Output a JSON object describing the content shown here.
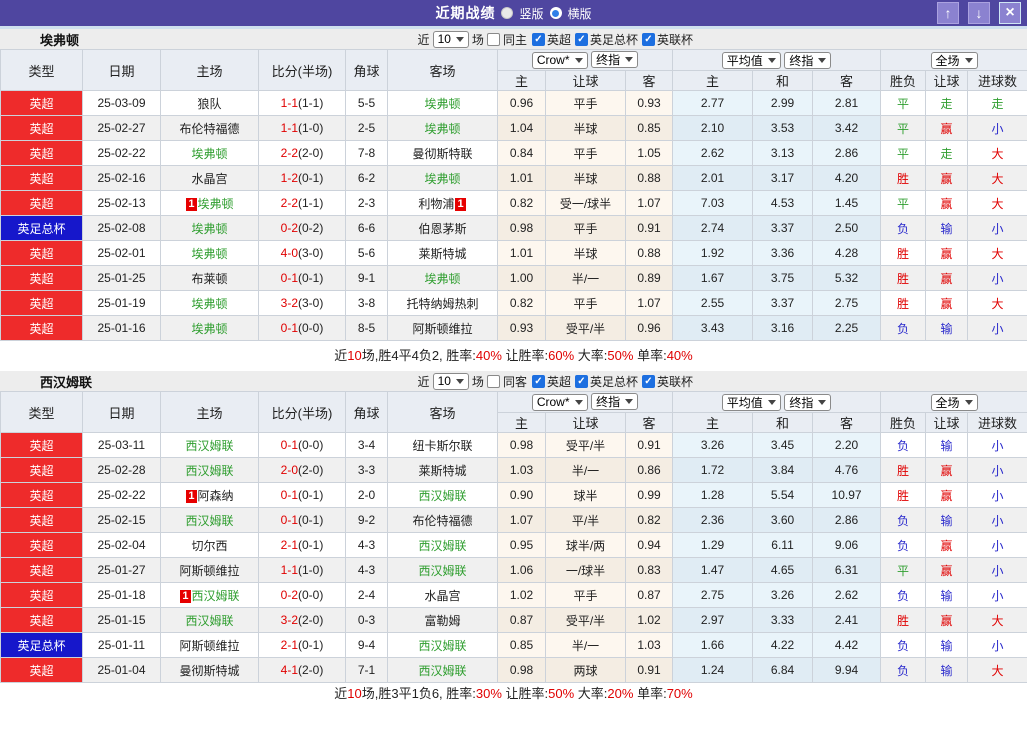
{
  "titlebar": {
    "title": "近期战绩",
    "radio_vertical": "竖版",
    "radio_horizontal": "横版",
    "up_button": "↑",
    "down_button": "↓",
    "close_button": "×"
  },
  "colors": {
    "header_purple": "#4f46a0",
    "league_red": "#ee2b2b",
    "cup_blue": "#1617cb",
    "team_green": "#2f9e2f",
    "score_red": "#e60000",
    "result_red": "#e00000",
    "result_blue": "#2929cc",
    "result_green": "#2f9e2f"
  },
  "controls": {
    "near_label": "近",
    "matches_value": "10",
    "matches_suffix": "场",
    "league_options": [
      "英超",
      "英足总杯",
      "英联杯"
    ]
  },
  "table_header": {
    "type": "类型",
    "date": "日期",
    "home": "主场",
    "score": "比分(半场)",
    "corner": "角球",
    "away": "客场",
    "group1": [
      "Crow*",
      "终指"
    ],
    "group2": [
      "平均值",
      "终指"
    ],
    "group3": [
      "全场"
    ],
    "sub1": [
      "主",
      "让球",
      "客"
    ],
    "sub2": [
      "主",
      "和",
      "客"
    ],
    "sub3": [
      "胜负",
      "让球",
      "进球数"
    ]
  },
  "sections": [
    {
      "team": "埃弗顿",
      "same_label": "同主",
      "rows": [
        {
          "lg": "英超",
          "lgc": "r",
          "date": "25-03-09",
          "home": {
            "t": "狼队"
          },
          "score": "1-1",
          "half": "(1-1)",
          "cor": "5-5",
          "away": {
            "t": "埃弗顿",
            "g": 1
          },
          "hc": [
            "0.96",
            "平手",
            "0.93"
          ],
          "avg": [
            "2.77",
            "2.99",
            "2.81"
          ],
          "res": [
            [
              "平",
              "g"
            ],
            [
              "走",
              "g"
            ],
            [
              "走",
              "g"
            ]
          ]
        },
        {
          "lg": "英超",
          "lgc": "r",
          "date": "25-02-27",
          "home": {
            "t": "布伦特福德"
          },
          "score": "1-1",
          "half": "(1-0)",
          "cor": "2-5",
          "away": {
            "t": "埃弗顿",
            "g": 1
          },
          "hc": [
            "1.04",
            "半球",
            "0.85"
          ],
          "avg": [
            "2.10",
            "3.53",
            "3.42"
          ],
          "res": [
            [
              "平",
              "g"
            ],
            [
              "赢",
              "r"
            ],
            [
              "小",
              "b"
            ]
          ]
        },
        {
          "lg": "英超",
          "lgc": "r",
          "date": "25-02-22",
          "home": {
            "t": "埃弗顿",
            "g": 1
          },
          "score": "2-2",
          "half": "(2-0)",
          "cor": "7-8",
          "away": {
            "t": "曼彻斯特联"
          },
          "hc": [
            "0.84",
            "平手",
            "1.05"
          ],
          "avg": [
            "2.62",
            "3.13",
            "2.86"
          ],
          "res": [
            [
              "平",
              "g"
            ],
            [
              "走",
              "g"
            ],
            [
              "大",
              "r"
            ]
          ]
        },
        {
          "lg": "英超",
          "lgc": "r",
          "date": "25-02-16",
          "home": {
            "t": "水晶宫"
          },
          "score": "1-2",
          "half": "(0-1)",
          "cor": "6-2",
          "away": {
            "t": "埃弗顿",
            "g": 1
          },
          "hc": [
            "1.01",
            "半球",
            "0.88"
          ],
          "avg": [
            "2.01",
            "3.17",
            "4.20"
          ],
          "res": [
            [
              "胜",
              "r"
            ],
            [
              "赢",
              "r"
            ],
            [
              "大",
              "r"
            ]
          ]
        },
        {
          "lg": "英超",
          "lgc": "r",
          "date": "25-02-13",
          "home": {
            "t": "埃弗顿",
            "g": 1,
            "pre": "1"
          },
          "score": "2-2",
          "half": "(1-1)",
          "cor": "2-3",
          "away": {
            "t": "利物浦",
            "post": "1"
          },
          "hc": [
            "0.82",
            "受一/球半",
            "1.07"
          ],
          "avg": [
            "7.03",
            "4.53",
            "1.45"
          ],
          "res": [
            [
              "平",
              "g"
            ],
            [
              "赢",
              "r"
            ],
            [
              "大",
              "r"
            ]
          ]
        },
        {
          "lg": "英足总杯",
          "lgc": "b",
          "date": "25-02-08",
          "home": {
            "t": "埃弗顿",
            "g": 1
          },
          "score": "0-2",
          "half": "(0-2)",
          "cor": "6-6",
          "away": {
            "t": "伯恩茅斯"
          },
          "hc": [
            "0.98",
            "平手",
            "0.91"
          ],
          "avg": [
            "2.74",
            "3.37",
            "2.50"
          ],
          "res": [
            [
              "负",
              "b"
            ],
            [
              "输",
              "b"
            ],
            [
              "小",
              "b"
            ]
          ]
        },
        {
          "lg": "英超",
          "lgc": "r",
          "date": "25-02-01",
          "home": {
            "t": "埃弗顿",
            "g": 1
          },
          "score": "4-0",
          "half": "(3-0)",
          "cor": "5-6",
          "away": {
            "t": "莱斯特城"
          },
          "hc": [
            "1.01",
            "半球",
            "0.88"
          ],
          "avg": [
            "1.92",
            "3.36",
            "4.28"
          ],
          "res": [
            [
              "胜",
              "r"
            ],
            [
              "赢",
              "r"
            ],
            [
              "大",
              "r"
            ]
          ]
        },
        {
          "lg": "英超",
          "lgc": "r",
          "date": "25-01-25",
          "home": {
            "t": "布莱顿"
          },
          "score": "0-1",
          "half": "(0-1)",
          "cor": "9-1",
          "away": {
            "t": "埃弗顿",
            "g": 1
          },
          "hc": [
            "1.00",
            "半/一",
            "0.89"
          ],
          "avg": [
            "1.67",
            "3.75",
            "5.32"
          ],
          "res": [
            [
              "胜",
              "r"
            ],
            [
              "赢",
              "r"
            ],
            [
              "小",
              "b"
            ]
          ]
        },
        {
          "lg": "英超",
          "lgc": "r",
          "date": "25-01-19",
          "home": {
            "t": "埃弗顿",
            "g": 1
          },
          "score": "3-2",
          "half": "(3-0)",
          "cor": "3-8",
          "away": {
            "t": "托特纳姆热刺"
          },
          "hc": [
            "0.82",
            "平手",
            "1.07"
          ],
          "avg": [
            "2.55",
            "3.37",
            "2.75"
          ],
          "res": [
            [
              "胜",
              "r"
            ],
            [
              "赢",
              "r"
            ],
            [
              "大",
              "r"
            ]
          ]
        },
        {
          "lg": "英超",
          "lgc": "r",
          "date": "25-01-16",
          "home": {
            "t": "埃弗顿",
            "g": 1
          },
          "score": "0-1",
          "half": "(0-0)",
          "cor": "8-5",
          "away": {
            "t": "阿斯顿维拉"
          },
          "hc": [
            "0.93",
            "受平/半",
            "0.96"
          ],
          "avg": [
            "3.43",
            "3.16",
            "2.25"
          ],
          "res": [
            [
              "负",
              "b"
            ],
            [
              "输",
              "b"
            ],
            [
              "小",
              "b"
            ]
          ]
        }
      ],
      "summary": [
        [
          "近",
          0
        ],
        [
          "10",
          1
        ],
        [
          "场,胜4平4负2, 胜率:",
          0
        ],
        [
          "40%",
          1
        ],
        [
          " 让胜率:",
          0
        ],
        [
          "60%",
          1
        ],
        [
          " 大率:",
          0
        ],
        [
          "50%",
          1
        ],
        [
          " 单率:",
          0
        ],
        [
          "40%",
          1
        ]
      ]
    },
    {
      "team": "西汉姆联",
      "same_label": "同客",
      "rows": [
        {
          "lg": "英超",
          "lgc": "r",
          "date": "25-03-11",
          "home": {
            "t": "西汉姆联",
            "g": 1
          },
          "score": "0-1",
          "half": "(0-0)",
          "cor": "3-4",
          "away": {
            "t": "纽卡斯尔联"
          },
          "hc": [
            "0.98",
            "受平/半",
            "0.91"
          ],
          "avg": [
            "3.26",
            "3.45",
            "2.20"
          ],
          "res": [
            [
              "负",
              "b"
            ],
            [
              "输",
              "b"
            ],
            [
              "小",
              "b"
            ]
          ]
        },
        {
          "lg": "英超",
          "lgc": "r",
          "date": "25-02-28",
          "home": {
            "t": "西汉姆联",
            "g": 1
          },
          "score": "2-0",
          "half": "(2-0)",
          "cor": "3-3",
          "away": {
            "t": "莱斯特城"
          },
          "hc": [
            "1.03",
            "半/一",
            "0.86"
          ],
          "avg": [
            "1.72",
            "3.84",
            "4.76"
          ],
          "res": [
            [
              "胜",
              "r"
            ],
            [
              "赢",
              "r"
            ],
            [
              "小",
              "b"
            ]
          ]
        },
        {
          "lg": "英超",
          "lgc": "r",
          "date": "25-02-22",
          "home": {
            "t": "阿森纳",
            "pre": "1"
          },
          "score": "0-1",
          "half": "(0-1)",
          "cor": "2-0",
          "away": {
            "t": "西汉姆联",
            "g": 1
          },
          "hc": [
            "0.90",
            "球半",
            "0.99"
          ],
          "avg": [
            "1.28",
            "5.54",
            "10.97"
          ],
          "res": [
            [
              "胜",
              "r"
            ],
            [
              "赢",
              "r"
            ],
            [
              "小",
              "b"
            ]
          ]
        },
        {
          "lg": "英超",
          "lgc": "r",
          "date": "25-02-15",
          "home": {
            "t": "西汉姆联",
            "g": 1
          },
          "score": "0-1",
          "half": "(0-1)",
          "cor": "9-2",
          "away": {
            "t": "布伦特福德"
          },
          "hc": [
            "1.07",
            "平/半",
            "0.82"
          ],
          "avg": [
            "2.36",
            "3.60",
            "2.86"
          ],
          "res": [
            [
              "负",
              "b"
            ],
            [
              "输",
              "b"
            ],
            [
              "小",
              "b"
            ]
          ]
        },
        {
          "lg": "英超",
          "lgc": "r",
          "date": "25-02-04",
          "home": {
            "t": "切尔西"
          },
          "score": "2-1",
          "half": "(0-1)",
          "cor": "4-3",
          "away": {
            "t": "西汉姆联",
            "g": 1
          },
          "hc": [
            "0.95",
            "球半/两",
            "0.94"
          ],
          "avg": [
            "1.29",
            "6.11",
            "9.06"
          ],
          "res": [
            [
              "负",
              "b"
            ],
            [
              "赢",
              "r"
            ],
            [
              "小",
              "b"
            ]
          ]
        },
        {
          "lg": "英超",
          "lgc": "r",
          "date": "25-01-27",
          "home": {
            "t": "阿斯顿维拉"
          },
          "score": "1-1",
          "half": "(1-0)",
          "cor": "4-3",
          "away": {
            "t": "西汉姆联",
            "g": 1
          },
          "hc": [
            "1.06",
            "一/球半",
            "0.83"
          ],
          "avg": [
            "1.47",
            "4.65",
            "6.31"
          ],
          "res": [
            [
              "平",
              "g"
            ],
            [
              "赢",
              "r"
            ],
            [
              "小",
              "b"
            ]
          ]
        },
        {
          "lg": "英超",
          "lgc": "r",
          "date": "25-01-18",
          "home": {
            "t": "西汉姆联",
            "g": 1,
            "pre": "1"
          },
          "score": "0-2",
          "half": "(0-0)",
          "cor": "2-4",
          "away": {
            "t": "水晶宫"
          },
          "hc": [
            "1.02",
            "平手",
            "0.87"
          ],
          "avg": [
            "2.75",
            "3.26",
            "2.62"
          ],
          "res": [
            [
              "负",
              "b"
            ],
            [
              "输",
              "b"
            ],
            [
              "小",
              "b"
            ]
          ]
        },
        {
          "lg": "英超",
          "lgc": "r",
          "date": "25-01-15",
          "home": {
            "t": "西汉姆联",
            "g": 1
          },
          "score": "3-2",
          "half": "(2-0)",
          "cor": "0-3",
          "away": {
            "t": "富勒姆"
          },
          "hc": [
            "0.87",
            "受平/半",
            "1.02"
          ],
          "avg": [
            "2.97",
            "3.33",
            "2.41"
          ],
          "res": [
            [
              "胜",
              "r"
            ],
            [
              "赢",
              "r"
            ],
            [
              "大",
              "r"
            ]
          ]
        },
        {
          "lg": "英足总杯",
          "lgc": "b",
          "date": "25-01-11",
          "home": {
            "t": "阿斯顿维拉"
          },
          "score": "2-1",
          "half": "(0-1)",
          "cor": "9-4",
          "away": {
            "t": "西汉姆联",
            "g": 1
          },
          "hc": [
            "0.85",
            "半/一",
            "1.03"
          ],
          "avg": [
            "1.66",
            "4.22",
            "4.42"
          ],
          "res": [
            [
              "负",
              "b"
            ],
            [
              "输",
              "b"
            ],
            [
              "小",
              "b"
            ]
          ]
        },
        {
          "lg": "英超",
          "lgc": "r",
          "date": "25-01-04",
          "home": {
            "t": "曼彻斯特城"
          },
          "score": "4-1",
          "half": "(2-0)",
          "cor": "7-1",
          "away": {
            "t": "西汉姆联",
            "g": 1
          },
          "hc": [
            "0.98",
            "两球",
            "0.91"
          ],
          "avg": [
            "1.24",
            "6.84",
            "9.94"
          ],
          "res": [
            [
              "负",
              "b"
            ],
            [
              "输",
              "b"
            ],
            [
              "大",
              "r"
            ]
          ]
        }
      ],
      "summary": [
        [
          "近",
          0
        ],
        [
          "10",
          1
        ],
        [
          "场,胜3平1负6, 胜率:",
          0
        ],
        [
          "30%",
          1
        ],
        [
          " 让胜率:",
          0
        ],
        [
          "50%",
          1
        ],
        [
          " 大率:",
          0
        ],
        [
          "20%",
          1
        ],
        [
          " 单率:",
          0
        ],
        [
          "70%",
          1
        ]
      ]
    }
  ]
}
